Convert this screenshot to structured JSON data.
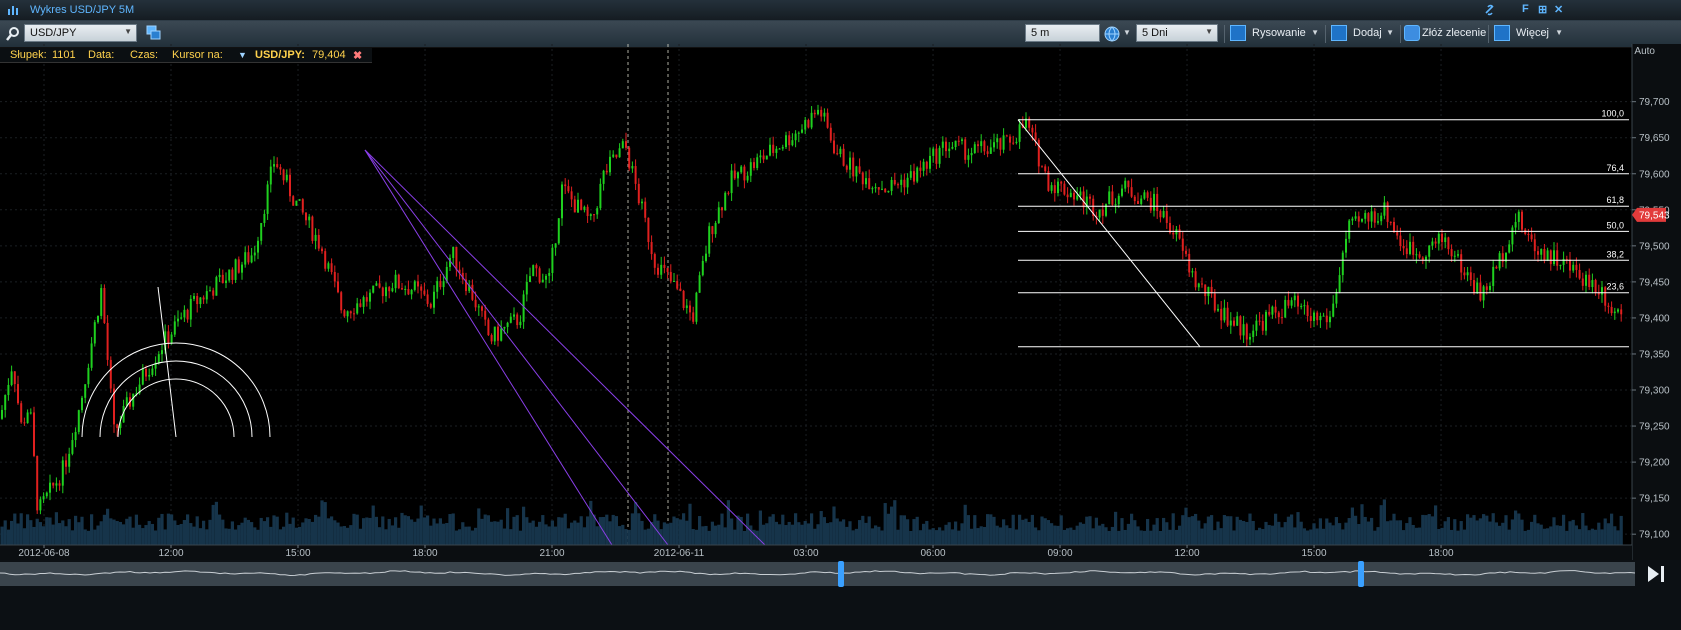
{
  "window": {
    "title": "Wykres USD/JPY 5M",
    "controls": [
      "F",
      "⊞",
      "✕"
    ]
  },
  "toolbar": {
    "symbol": "USD/JPY",
    "interval": "5 m",
    "range": "5 Dni",
    "drawing_label": "Rysowanie",
    "add_label": "Dodaj",
    "order_label": "Złóż zlecenie",
    "more_label": "Więcej"
  },
  "infobar": {
    "bar_label": "Słupek:",
    "bar_value": "1101",
    "date_label": "Data:",
    "time_label": "Czas:",
    "cursor_label": "Kursor na:",
    "instrument": "USD/JPY:",
    "value": "79,404"
  },
  "chart_data": {
    "type": "candlestick",
    "instrument": "USD/JPY",
    "scale": "Auto",
    "ylim": [
      79.085,
      79.78
    ],
    "y_ticks": [
      "79,700",
      "79,650",
      "79,600",
      "79,550",
      "79,500",
      "79,450",
      "79,400",
      "79,350",
      "79,300",
      "79,250",
      "79,200",
      "79,150",
      "79,100"
    ],
    "current_price": "79,543",
    "x_ticks": [
      "2012-06-08",
      "12:00",
      "15:00",
      "18:00",
      "21:00",
      "2012-06-11",
      "03:00",
      "06:00",
      "09:00",
      "12:00",
      "15:00",
      "18:00"
    ],
    "fibonacci_levels": [
      "100,0",
      "76,4",
      "61,8",
      "50,0",
      "38,2",
      "23,6"
    ],
    "fibonacci_prices": [
      79.675,
      79.6,
      79.555,
      79.52,
      79.48,
      79.435,
      79.36
    ],
    "price_path": [
      [
        0,
        79.26
      ],
      [
        0.3,
        79.34
      ],
      [
        0.5,
        79.25
      ],
      [
        0.7,
        79.28
      ],
      [
        0.9,
        79.13
      ],
      [
        1.2,
        79.16
      ],
      [
        1.5,
        79.19
      ],
      [
        1.9,
        79.28
      ],
      [
        2.4,
        79.44
      ],
      [
        2.7,
        79.24
      ],
      [
        3.2,
        79.3
      ],
      [
        3.8,
        79.36
      ],
      [
        4.3,
        79.4
      ],
      [
        4.6,
        79.42
      ],
      [
        5.2,
        79.45
      ],
      [
        6.0,
        79.49
      ],
      [
        6.5,
        79.62
      ],
      [
        7.0,
        79.56
      ],
      [
        7.6,
        79.5
      ],
      [
        8.1,
        79.41
      ],
      [
        8.8,
        79.43
      ],
      [
        9.3,
        79.45
      ],
      [
        9.8,
        79.44
      ],
      [
        10.2,
        79.42
      ],
      [
        10.7,
        79.49
      ],
      [
        11.2,
        79.43
      ],
      [
        11.6,
        79.37
      ],
      [
        12.3,
        79.4
      ],
      [
        12.6,
        79.47
      ],
      [
        13.0,
        79.45
      ],
      [
        13.3,
        79.58
      ],
      [
        14.0,
        79.53
      ],
      [
        14.3,
        79.6
      ],
      [
        14.8,
        79.64
      ],
      [
        15.5,
        79.48
      ],
      [
        16.0,
        79.44
      ],
      [
        16.4,
        79.4
      ],
      [
        16.8,
        79.52
      ],
      [
        17.3,
        79.59
      ],
      [
        18.0,
        79.62
      ],
      [
        18.9,
        79.66
      ],
      [
        19.4,
        79.69
      ],
      [
        19.8,
        79.63
      ],
      [
        20.3,
        79.6
      ],
      [
        21.0,
        79.58
      ],
      [
        21.7,
        79.6
      ],
      [
        22.4,
        79.64
      ],
      [
        23.0,
        79.63
      ],
      [
        23.8,
        79.64
      ],
      [
        24.3,
        79.67
      ],
      [
        24.8,
        79.59
      ],
      [
        25.5,
        79.57
      ],
      [
        26.0,
        79.55
      ],
      [
        26.6,
        79.58
      ],
      [
        27.3,
        79.56
      ],
      [
        27.8,
        79.52
      ],
      [
        28.3,
        79.45
      ],
      [
        28.9,
        79.41
      ],
      [
        29.5,
        79.38
      ],
      [
        30.0,
        79.4
      ],
      [
        30.6,
        79.42
      ],
      [
        31.0,
        79.4
      ],
      [
        31.5,
        79.4
      ],
      [
        31.9,
        79.52
      ],
      [
        32.4,
        79.54
      ],
      [
        32.8,
        79.55
      ],
      [
        33.2,
        79.5
      ],
      [
        33.6,
        79.49
      ],
      [
        34.2,
        79.51
      ],
      [
        34.6,
        79.47
      ],
      [
        35.1,
        79.43
      ],
      [
        35.5,
        79.48
      ],
      [
        35.9,
        79.54
      ],
      [
        36.3,
        79.5
      ],
      [
        36.9,
        79.48
      ],
      [
        37.4,
        79.46
      ],
      [
        37.9,
        79.44
      ],
      [
        38.2,
        79.41
      ]
    ],
    "volume_level": "low"
  },
  "navigator": {
    "end_icon": "skip-end-icon"
  }
}
